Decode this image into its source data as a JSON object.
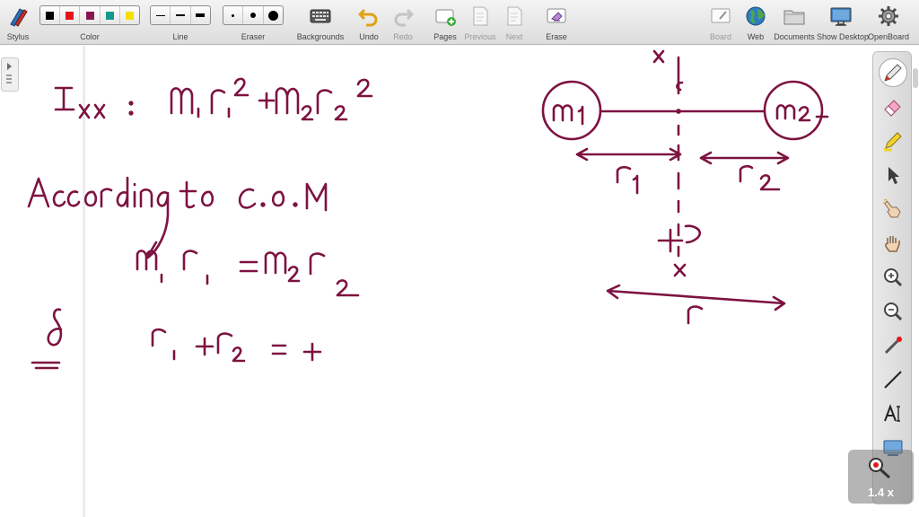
{
  "toolbar": {
    "stylus": "Stylus",
    "color": "Color",
    "line": "Line",
    "eraser": "Eraser",
    "backgrounds": "Backgrounds",
    "undo": "Undo",
    "redo": "Redo",
    "pages": "Pages",
    "previous": "Previous",
    "next": "Next",
    "erase": "Erase",
    "board": "Board",
    "web": "Web",
    "documents": "Documents",
    "show_desktop": "Show Desktop",
    "openboard": "OpenBoard"
  },
  "colors": {
    "palette": [
      "#000000",
      "#e4161b",
      "#8a1650",
      "#139a8f",
      "#f4e000"
    ],
    "ink": "#7d1241",
    "accent": "#2d7cc0"
  },
  "icons": {
    "stylus": "stylus-icon",
    "backgrounds": "keyboard-icon",
    "undo": "undo-icon",
    "redo": "redo-icon",
    "pages": "add-page-icon",
    "previous": "previous-page-icon",
    "next": "next-page-icon",
    "erase": "erase-page-icon",
    "board": "board-icon",
    "web": "globe-icon",
    "documents": "folder-icon",
    "show_desktop": "monitor-icon",
    "openboard": "gear-icon"
  },
  "zoom": {
    "level": "1.4 x"
  }
}
